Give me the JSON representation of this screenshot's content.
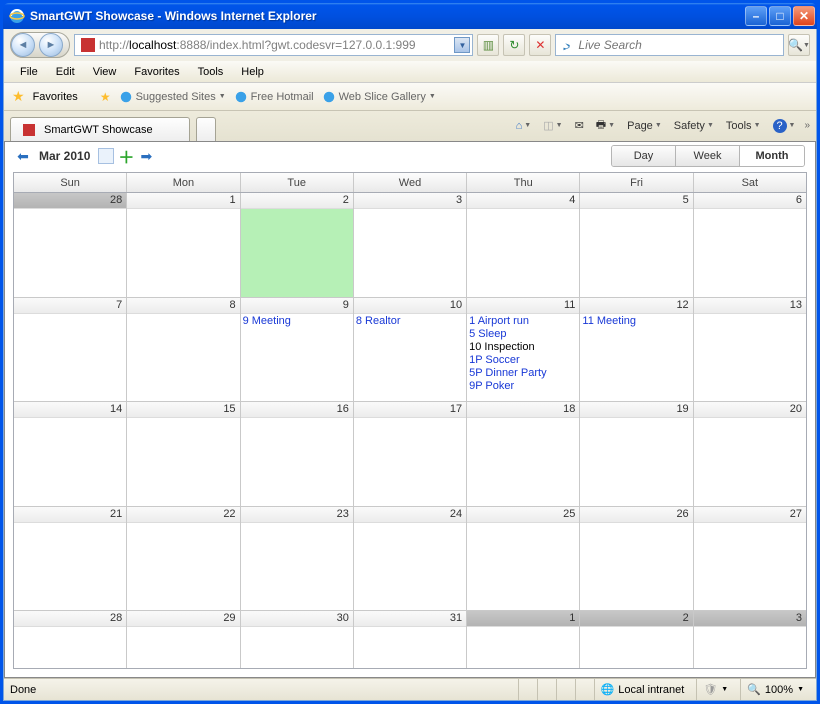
{
  "window": {
    "title": "SmartGWT Showcase - Windows Internet Explorer"
  },
  "address": {
    "prefix": "http://",
    "host": "localhost",
    "rest": ":8888/index.html?gwt.codesvr=127.0.0.1:999"
  },
  "search": {
    "placeholder": "Live Search"
  },
  "menu": [
    "File",
    "Edit",
    "View",
    "Favorites",
    "Tools",
    "Help"
  ],
  "favorites": {
    "label": "Favorites",
    "links": [
      {
        "label": "Suggested Sites",
        "dd": true
      },
      {
        "label": "Free Hotmail",
        "dd": false
      },
      {
        "label": "Web Slice Gallery",
        "dd": true
      }
    ]
  },
  "tab": {
    "title": "SmartGWT Showcase"
  },
  "cmdbar": {
    "page": "Page",
    "safety": "Safety",
    "tools": "Tools"
  },
  "calendar": {
    "title": "Mar 2010",
    "views": {
      "day": "Day",
      "week": "Week",
      "month": "Month"
    },
    "dayheads": [
      "Sun",
      "Mon",
      "Tue",
      "Wed",
      "Thu",
      "Fri",
      "Sat"
    ],
    "weeks": [
      [
        {
          "n": 28,
          "out": true
        },
        {
          "n": 1
        },
        {
          "n": 2,
          "today": true
        },
        {
          "n": 3
        },
        {
          "n": 4
        },
        {
          "n": 5
        },
        {
          "n": 6
        }
      ],
      [
        {
          "n": 7
        },
        {
          "n": 8
        },
        {
          "n": 9,
          "events": [
            {
              "t": "9 Meeting"
            }
          ]
        },
        {
          "n": 10,
          "events": [
            {
              "t": "8 Realtor"
            }
          ]
        },
        {
          "n": 11,
          "events": [
            {
              "t": "1 Airport run"
            },
            {
              "t": "5 Sleep"
            },
            {
              "t": "10 Inspection",
              "k": "black"
            },
            {
              "t": "1P Soccer"
            },
            {
              "t": "5P Dinner Party"
            },
            {
              "t": "9P Poker"
            }
          ]
        },
        {
          "n": 12,
          "events": [
            {
              "t": "11 Meeting"
            }
          ]
        },
        {
          "n": 13
        }
      ],
      [
        {
          "n": 14
        },
        {
          "n": 15
        },
        {
          "n": 16
        },
        {
          "n": 17
        },
        {
          "n": 18
        },
        {
          "n": 19
        },
        {
          "n": 20
        }
      ],
      [
        {
          "n": 21
        },
        {
          "n": 22
        },
        {
          "n": 23
        },
        {
          "n": 24
        },
        {
          "n": 25
        },
        {
          "n": 26
        },
        {
          "n": 27
        }
      ],
      [
        {
          "n": 28
        },
        {
          "n": 29
        },
        {
          "n": 30
        },
        {
          "n": 31
        },
        {
          "n": 1,
          "out": true
        },
        {
          "n": 2,
          "out": true
        },
        {
          "n": 3,
          "out": true
        }
      ]
    ]
  },
  "status": {
    "done": "Done",
    "zone": "Local intranet",
    "zoom": "100%"
  }
}
